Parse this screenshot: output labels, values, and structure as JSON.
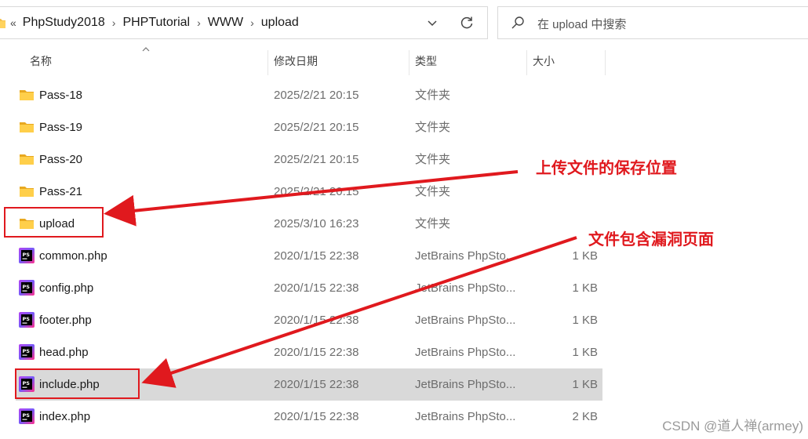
{
  "address_bar": {
    "overflow_glyph": "«",
    "crumbs": [
      "PhpStudy2018",
      "PHPTutorial",
      "WWW",
      "upload"
    ]
  },
  "search": {
    "placeholder": "在 upload 中搜索"
  },
  "columns": {
    "name": "名称",
    "date": "修改日期",
    "type": "类型",
    "size": "大小"
  },
  "files": [
    {
      "name": "Pass-18",
      "date": "2025/2/21 20:15",
      "type": "文件夹",
      "size": "",
      "kind": "folder"
    },
    {
      "name": "Pass-19",
      "date": "2025/2/21 20:15",
      "type": "文件夹",
      "size": "",
      "kind": "folder"
    },
    {
      "name": "Pass-20",
      "date": "2025/2/21 20:15",
      "type": "文件夹",
      "size": "",
      "kind": "folder"
    },
    {
      "name": "Pass-21",
      "date": "2025/2/21 20:15",
      "type": "文件夹",
      "size": "",
      "kind": "folder"
    },
    {
      "name": "upload",
      "date": "2025/3/10 16:23",
      "type": "文件夹",
      "size": "",
      "kind": "folder"
    },
    {
      "name": "common.php",
      "date": "2020/1/15 22:38",
      "type": "JetBrains PhpSto...",
      "size": "1 KB",
      "kind": "php"
    },
    {
      "name": "config.php",
      "date": "2020/1/15 22:38",
      "type": "JetBrains PhpSto...",
      "size": "1 KB",
      "kind": "php"
    },
    {
      "name": "footer.php",
      "date": "2020/1/15 22:38",
      "type": "JetBrains PhpSto...",
      "size": "1 KB",
      "kind": "php"
    },
    {
      "name": "head.php",
      "date": "2020/1/15 22:38",
      "type": "JetBrains PhpSto...",
      "size": "1 KB",
      "kind": "php"
    },
    {
      "name": "include.php",
      "date": "2020/1/15 22:38",
      "type": "JetBrains PhpSto...",
      "size": "1 KB",
      "kind": "php",
      "selected": true
    },
    {
      "name": "index.php",
      "date": "2020/1/15 22:38",
      "type": "JetBrains PhpSto...",
      "size": "2 KB",
      "kind": "php"
    }
  ],
  "annotations": {
    "upload_note": "上传文件的保存位置",
    "include_note": "文件包含漏洞页面",
    "color": "#e0191e"
  },
  "watermark": "CSDN @道人禅(armey)",
  "icons": {
    "folder": "folder-icon",
    "php": "phpstorm-file-icon",
    "search": "search-icon",
    "refresh": "refresh-icon",
    "dropdown": "chevron-down-icon",
    "sort": "sort-ascending-icon"
  }
}
